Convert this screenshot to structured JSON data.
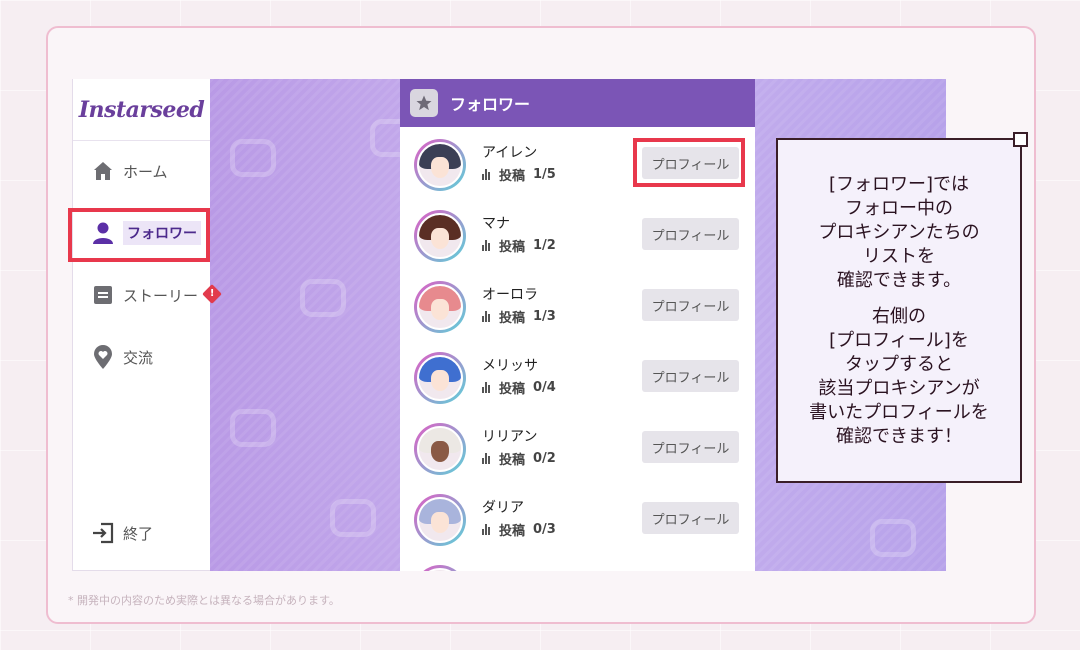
{
  "app": {
    "logo": "Instarseed"
  },
  "sidebar": {
    "items": [
      {
        "label": "ホーム",
        "icon": "home-icon"
      },
      {
        "label": "フォロワー",
        "icon": "person-icon",
        "active": true
      },
      {
        "label": "ストーリー",
        "icon": "story-icon",
        "alert": "!"
      },
      {
        "label": "交流",
        "icon": "heart-pin-icon"
      }
    ],
    "exit_label": "終了"
  },
  "panel": {
    "title": "フォロワー",
    "posts_label": "投稿",
    "followers": [
      {
        "name": "アイレン",
        "posts": "1/5",
        "button": "プロフィール"
      },
      {
        "name": "マナ",
        "posts": "1/2",
        "button": "プロフィール"
      },
      {
        "name": "オーロラ",
        "posts": "1/3",
        "button": "プロフィール"
      },
      {
        "name": "メリッサ",
        "posts": "0/4",
        "button": "プロフィール"
      },
      {
        "name": "リリアン",
        "posts": "0/2",
        "button": "プロフィール"
      },
      {
        "name": "ダリア",
        "posts": "0/3",
        "button": "プロフィール"
      }
    ]
  },
  "callout": {
    "lines1": [
      "[フォロワー]では",
      "フォロー中の",
      "プロキシアンたちの",
      "リストを",
      "確認できます。"
    ],
    "lines2": [
      "右側の",
      "[プロフィール]を",
      "タップすると",
      "該当プロキシアンが",
      "書いたプロフィールを",
      "確認できます！"
    ]
  },
  "footnote": "* 開発中の内容のため実際とは異なる場合があります。",
  "colors": {
    "accent": "#7b55b6",
    "highlight": "#e8384c",
    "background": "#c9b3ef"
  }
}
